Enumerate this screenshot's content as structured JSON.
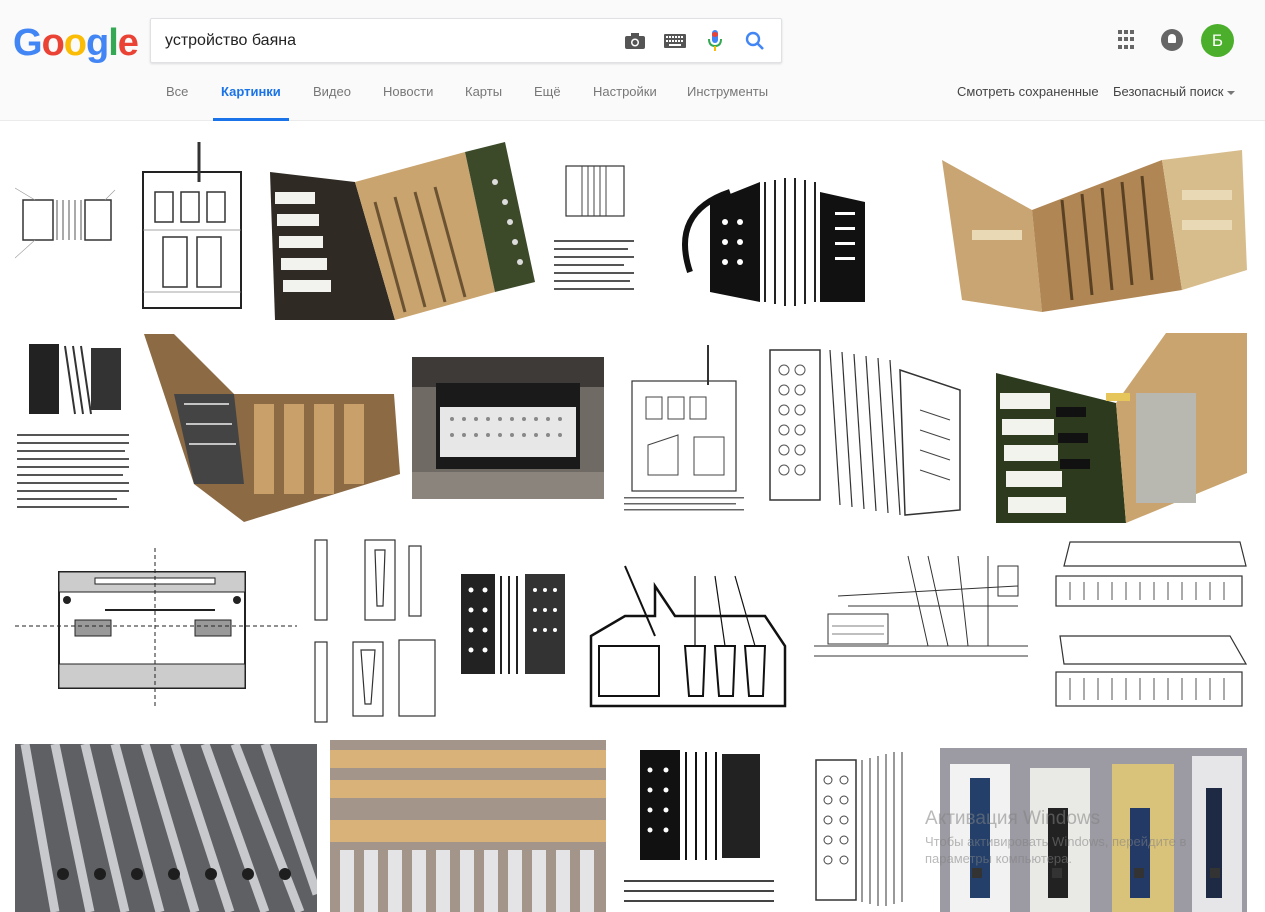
{
  "logo": {
    "letters": [
      "G",
      "o",
      "o",
      "g",
      "l",
      "e"
    ],
    "colors": [
      "#4285f4",
      "#ea4335",
      "#fbbc05",
      "#4285f4",
      "#34a853",
      "#ea4335"
    ]
  },
  "search": {
    "value": "устройство баяна"
  },
  "account": {
    "initial": "Б",
    "avatar_color": "#4caf2c"
  },
  "tabs": [
    {
      "label": "Все",
      "active": false
    },
    {
      "label": "Картинки",
      "active": true
    },
    {
      "label": "Видео",
      "active": false
    },
    {
      "label": "Новости",
      "active": false
    },
    {
      "label": "Карты",
      "active": false
    },
    {
      "label": "Ещё",
      "active": false
    },
    {
      "label": "Настройки",
      "active": false
    },
    {
      "label": "Инструменты",
      "active": false
    }
  ],
  "right_links": {
    "saved": "Смотреть сохраненные",
    "safe_search": "Безопасный поиск"
  },
  "colors": {
    "accent": "#1a73e8",
    "mic_blue": "#4285f4",
    "mic_red": "#ea4335"
  },
  "watermark": {
    "title": "Активация Windows",
    "subtitle": "Чтобы активировать Windows, перейдите в",
    "subtitle2": "параметры компьютера."
  }
}
